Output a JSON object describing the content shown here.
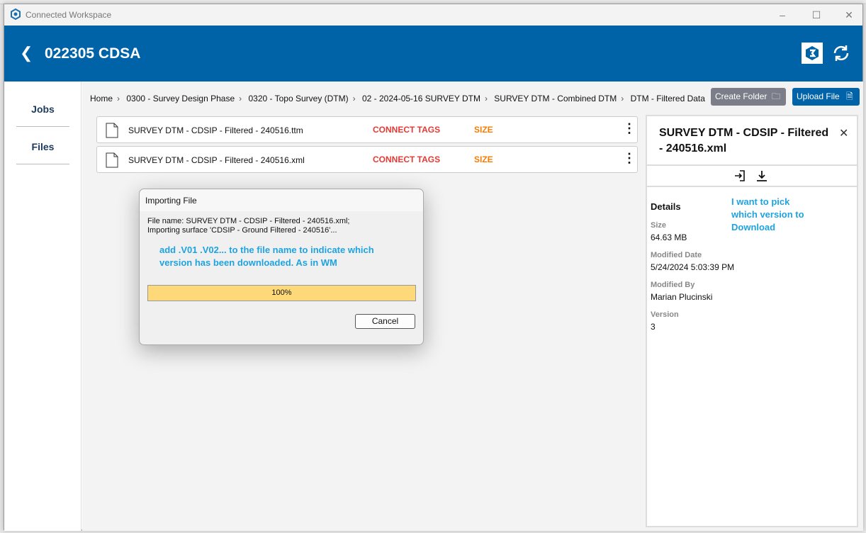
{
  "window": {
    "title": "Connected Workspace",
    "controls": [
      "minimize",
      "maximize",
      "close"
    ]
  },
  "header": {
    "title": "022305 CDSA"
  },
  "sidebar": {
    "items": [
      {
        "label": "Jobs"
      },
      {
        "label": "Files"
      }
    ]
  },
  "breadcrumb": [
    "Home",
    "0300 - Survey Design Phase",
    "0320 - Topo Survey (DTM)",
    "02 - 2024-05-16 SURVEY DTM",
    "SURVEY DTM - Combined DTM",
    "DTM - Filtered Data"
  ],
  "toolbar": {
    "create_folder": "Create Folder",
    "upload_file": "Upload File"
  },
  "files": [
    {
      "name": "SURVEY DTM - CDSIP - Filtered - 240516.ttm",
      "tags": "CONNECT TAGS",
      "size": "SIZE"
    },
    {
      "name": "SURVEY DTM - CDSIP - Filtered - 240516.xml",
      "tags": "CONNECT TAGS",
      "size": "SIZE"
    }
  ],
  "details": {
    "title": "SURVEY DTM - CDSIP - Filtered - 240516.xml",
    "heading": "Details",
    "size_label": "Size",
    "size": "64.63 MB",
    "modified_date_label": "Modified Date",
    "modified_date": "5/24/2024 5:03:39 PM",
    "modified_by_label": "Modified By",
    "modified_by": "Marian Plucinski",
    "version_label": "Version",
    "version": "3",
    "note": "I want to pick which version to Download"
  },
  "dialog": {
    "title": "Importing File",
    "line1": "File name: SURVEY DTM - CDSIP - Filtered - 240516.xml;",
    "line2": "Importing surface 'CDSIP - Ground Filtered - 240516'...",
    "note": "add .V01 .V02... to the file name to indicate which version has been downloaded. As in WM",
    "progress_label": "100%",
    "progress": 1.0,
    "cancel": "Cancel"
  }
}
